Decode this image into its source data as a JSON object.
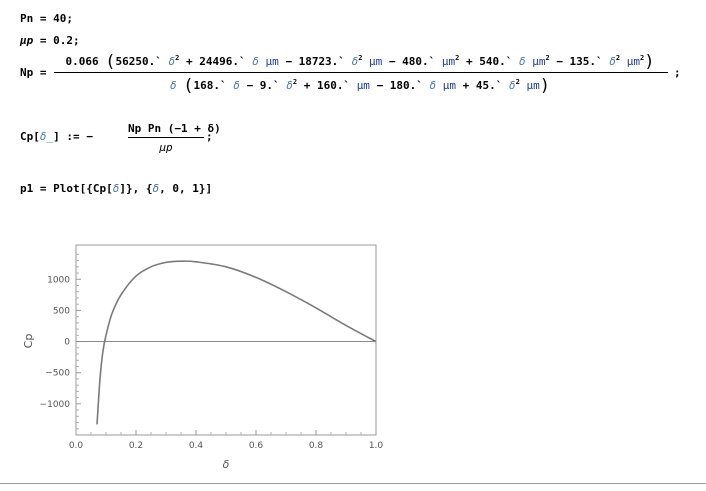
{
  "cells": {
    "pn_line": "Pn = 40;",
    "mup_line_name": "μp",
    "mup_line_rest": " =  0.2;",
    "np_label": "Np =",
    "np_num_coef": "0.066",
    "np_num_inner_1": "56250.` ",
    "np_num_inner_2": " + 24496.` ",
    "np_num_inner_3": " μm",
    "np_num_inner_4": " − 18723.` ",
    "np_num_inner_5": " μm",
    "np_num_inner_6": " − 480.` ",
    "np_num_inner_7": "μm",
    "np_num_inner_8": " + 540.` ",
    "np_num_inner_9": " μm",
    "np_num_inner_10": " − 135.` ",
    "np_num_inner_11": " μm",
    "np_den_1": "168.` ",
    "np_den_2": " − 9.` ",
    "np_den_3": " + 160.` ",
    "np_den_4": "μm",
    "np_den_5": " − 180.` ",
    "np_den_6": " μm",
    "np_den_7": " + 45.` ",
    "np_den_8": " μm",
    "delta": "δ",
    "cp_def_lhs": "Cp[",
    "cp_def_arg": "δ_",
    "cp_def_mid": "] := −",
    "cp_def_num": "Np Pn (−1 + δ)",
    "cp_def_den": "μp",
    "semicolon": ";",
    "plot_cmd_1": "p1 = Plot[{Cp[",
    "plot_cmd_2": "]}, {",
    "plot_cmd_3": ", 0, 1}]"
  },
  "chart_data": {
    "type": "line",
    "xlabel": "δ",
    "ylabel": "Cp",
    "xlim": [
      0,
      1
    ],
    "ylim": [
      -1500,
      1550
    ],
    "x_ticks": [
      0.0,
      0.2,
      0.4,
      0.6,
      0.8,
      1.0
    ],
    "x_tick_labels": [
      "0.0",
      "0.2",
      "0.4",
      "0.6",
      "0.8",
      "1.0"
    ],
    "y_ticks": [
      -1000,
      -500,
      0,
      500,
      1000
    ],
    "y_tick_labels": [
      "−1000",
      "−500",
      "0",
      "500",
      "1000"
    ],
    "series": [
      {
        "color": "#7a7a7a",
        "x": [
          0.07,
          0.08,
          0.09,
          0.1,
          0.12,
          0.15,
          0.2,
          0.25,
          0.3,
          0.35,
          0.4,
          0.5,
          0.6,
          0.7,
          0.8,
          0.9,
          1.0
        ],
        "y": [
          -1330,
          -600,
          -150,
          100,
          450,
          750,
          1050,
          1200,
          1270,
          1290,
          1280,
          1200,
          1030,
          800,
          540,
          260,
          0
        ]
      }
    ]
  }
}
